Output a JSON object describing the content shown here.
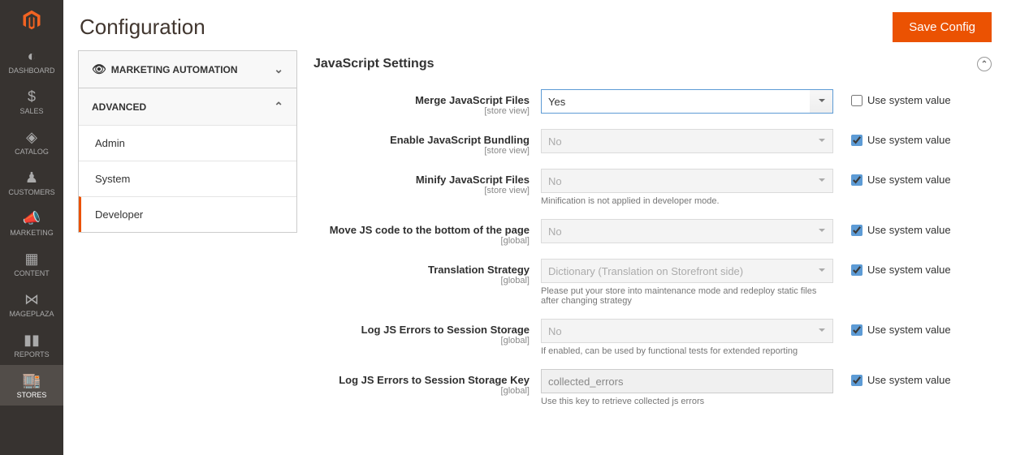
{
  "page": {
    "title": "Configuration",
    "save": "Save Config"
  },
  "sidebar": {
    "items": [
      {
        "label": "DASHBOARD"
      },
      {
        "label": "SALES"
      },
      {
        "label": "CATALOG"
      },
      {
        "label": "CUSTOMERS"
      },
      {
        "label": "MARKETING"
      },
      {
        "label": "CONTENT"
      },
      {
        "label": "MAGEPLAZA"
      },
      {
        "label": "REPORTS"
      },
      {
        "label": "STORES"
      }
    ]
  },
  "config_nav": {
    "sections": [
      {
        "label": "MARKETING AUTOMATION",
        "has_eye": true,
        "collapsed": true
      },
      {
        "label": "ADVANCED",
        "collapsed": false,
        "items": [
          {
            "label": "Admin"
          },
          {
            "label": "System"
          },
          {
            "label": "Developer",
            "active": true
          }
        ]
      }
    ]
  },
  "form": {
    "section_title": "JavaScript Settings",
    "use_system_label": "Use system value",
    "fields": {
      "merge_js": {
        "label": "Merge JavaScript Files",
        "scope": "[store view]",
        "value": "Yes",
        "disabled": false,
        "use_system": false
      },
      "bundle_js": {
        "label": "Enable JavaScript Bundling",
        "scope": "[store view]",
        "value": "No",
        "disabled": true,
        "use_system": true
      },
      "minify_js": {
        "label": "Minify JavaScript Files",
        "scope": "[store view]",
        "value": "No",
        "disabled": true,
        "use_system": true,
        "note": "Minification is not applied in developer mode."
      },
      "move_js": {
        "label": "Move JS code to the bottom of the page",
        "scope": "[global]",
        "value": "No",
        "disabled": true,
        "use_system": true
      },
      "trans_strat": {
        "label": "Translation Strategy",
        "scope": "[global]",
        "value": "Dictionary (Translation on Storefront side)",
        "disabled": true,
        "use_system": true,
        "note": "Please put your store into maintenance mode and redeploy static files after changing strategy"
      },
      "log_err": {
        "label": "Log JS Errors to Session Storage",
        "scope": "[global]",
        "value": "No",
        "disabled": true,
        "use_system": true,
        "note": "If enabled, can be used by functional tests for extended reporting"
      },
      "log_key": {
        "label": "Log JS Errors to Session Storage Key",
        "scope": "[global]",
        "value": "collected_errors",
        "disabled": true,
        "use_system": true,
        "note": "Use this key to retrieve collected js errors",
        "is_text": true
      }
    }
  }
}
